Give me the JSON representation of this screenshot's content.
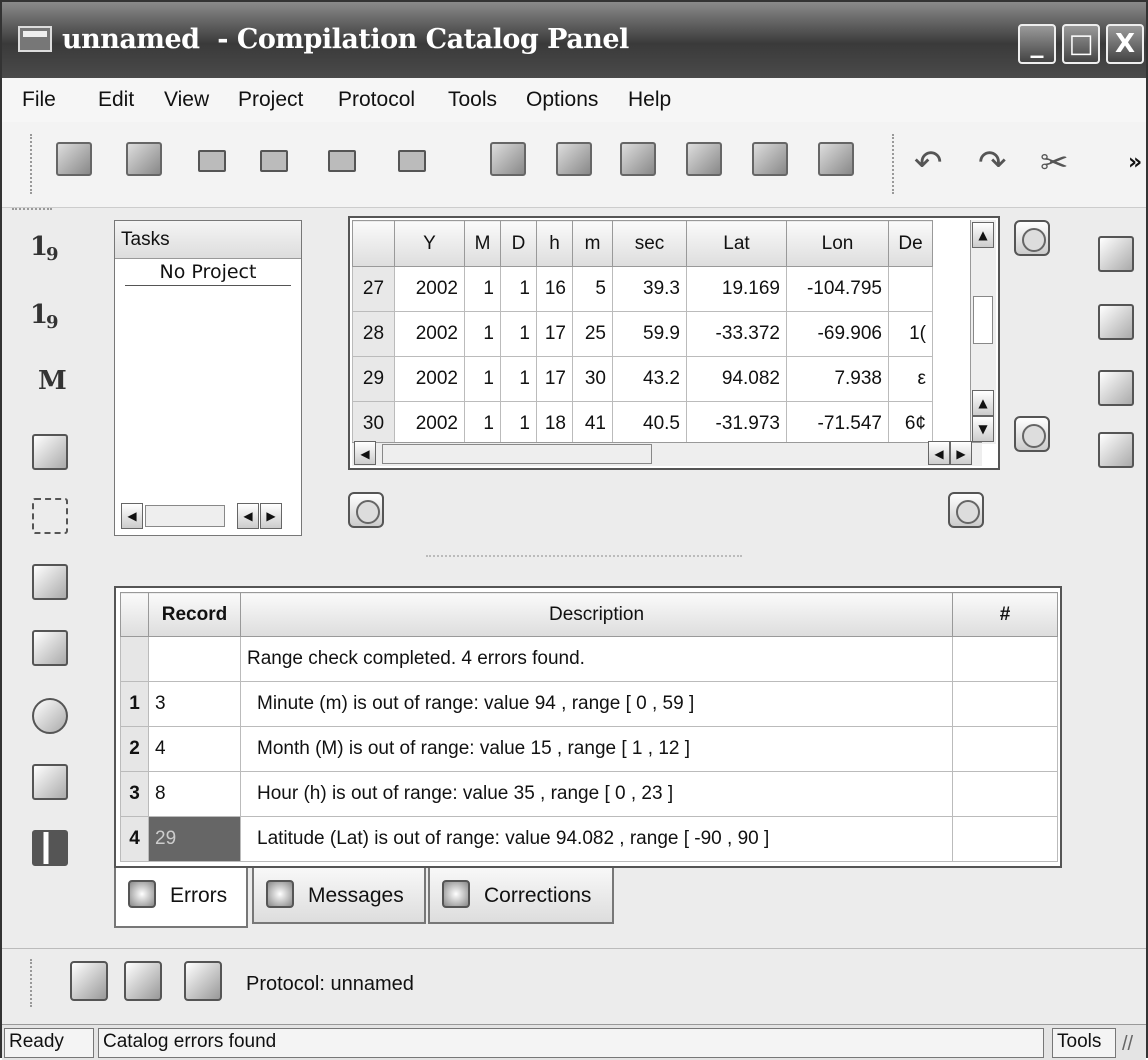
{
  "window": {
    "title": "unnamed  - Compilation Catalog Panel",
    "minimize": "_",
    "maximize": "□",
    "close": "X"
  },
  "menu": [
    "File",
    "Edit",
    "View",
    "Project",
    "Protocol",
    "Tools",
    "Options",
    "Help"
  ],
  "toolbar": {
    "overflow": "»",
    "icons": [
      "open-icon",
      "open-project-icon",
      "save-icon",
      "save-all-icon",
      "save-as-icon",
      "print-icon",
      "new-window-icon",
      "open-catalog-icon",
      "edit-catalog-icon",
      "settings-catalog-icon",
      "save-catalog-icon",
      "export-catalog-icon",
      "undo-icon",
      "redo-icon",
      "cut-icon"
    ]
  },
  "leftbar": {
    "icons": [
      "ticks-1-9-icon",
      "sort-1-9-icon",
      "magnitude-icon",
      "list-view-icon",
      "polygon-select-icon",
      "tree-icon",
      "tree-insert-icon",
      "search-range-icon",
      "report-icon",
      "histogram-icon"
    ],
    "labels": {
      "ticks": "1",
      "ticks_b": "9",
      "sort": "1",
      "sort_b": "9",
      "mag": "M"
    }
  },
  "tasks": {
    "header": "Tasks",
    "project": "No Project"
  },
  "catalog": {
    "columns": [
      "",
      "Y",
      "M",
      "D",
      "h",
      "m",
      "sec",
      "Lat",
      "Lon",
      "De"
    ],
    "rows": [
      [
        "27",
        "2002",
        "1",
        "1",
        "16",
        "5",
        "39.3",
        "19.169",
        "-104.795",
        ""
      ],
      [
        "28",
        "2002",
        "1",
        "1",
        "17",
        "25",
        "59.9",
        "-33.372",
        "-69.906",
        "1("
      ],
      [
        "29",
        "2002",
        "1",
        "1",
        "17",
        "30",
        "43.2",
        "94.082",
        "7.938",
        "ε"
      ],
      [
        "30",
        "2002",
        "1",
        "1",
        "18",
        "41",
        "40.5",
        "-31.973",
        "-71.547",
        "6¢"
      ]
    ]
  },
  "errors": {
    "columns": [
      "",
      "Record",
      "Description",
      "#"
    ],
    "summary": "Range check completed. 4 errors found.",
    "rows": [
      {
        "n": "1",
        "record": "3",
        "desc": "Minute (m) is out of range: value 94 , range [ 0 , 59 ]"
      },
      {
        "n": "2",
        "record": "4",
        "desc": "Month (M) is out of range: value 15 , range [ 1 , 12 ]"
      },
      {
        "n": "3",
        "record": "8",
        "desc": "Hour (h) is out of range: value 35 , range [ 0 , 23 ]"
      },
      {
        "n": "4",
        "record": "29",
        "desc": "Latitude (Lat) is out of range: value 94.082 , range [ -90 , 90 ]"
      }
    ]
  },
  "tabs": [
    "Errors",
    "Messages",
    "Corrections"
  ],
  "protocol": {
    "label": "Protocol: unnamed"
  },
  "status": {
    "ready": "Ready",
    "message": "Catalog errors found",
    "tools": "Tools"
  }
}
